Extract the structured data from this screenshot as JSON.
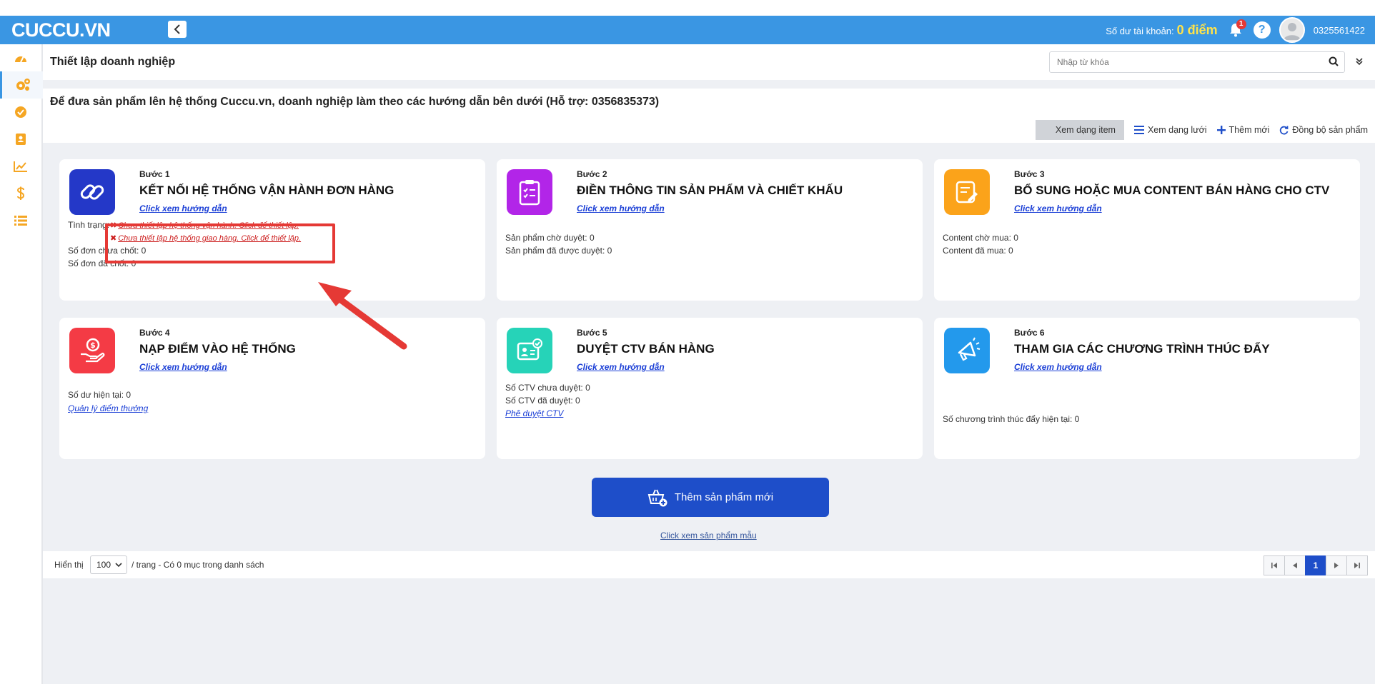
{
  "app": {
    "logo": "CUCCU.VN",
    "balance_label": "Số dư tài khoản:",
    "balance_value": "0 điểm",
    "notification_count": "1",
    "help_symbol": "?",
    "username": "0325561422"
  },
  "sidebar": {
    "items": [
      {
        "icon": "dashboard-icon"
      },
      {
        "icon": "settings-icon",
        "active": true
      },
      {
        "icon": "check-circle-icon"
      },
      {
        "icon": "contact-book-icon"
      },
      {
        "icon": "chart-line-icon"
      },
      {
        "icon": "dollar-icon"
      },
      {
        "icon": "list-icon"
      }
    ]
  },
  "header": {
    "title": "Thiết lập doanh nghiệp",
    "search_placeholder": "Nhập từ khóa"
  },
  "guide": {
    "text": "Để đưa sản phẩm lên hệ thống Cuccu.vn, doanh nghiệp làm theo các hướng dẫn bên dưới (Hỗ trợ: 0356835373)"
  },
  "view_tools": {
    "item_view": "Xem dạng item",
    "grid_view": "Xem dạng lưới",
    "add_new": "Thêm mới",
    "sync": "Đồng bộ sản phẩm"
  },
  "steps": [
    {
      "step": "Bước 1",
      "title": "KẾT NỐI HỆ THỐNG VẬN HÀNH ĐƠN HÀNG",
      "link": "Click xem hướng dẫn",
      "color": "#2438c8",
      "status_label": "Tình trạng:",
      "warnings": [
        "Chưa thiết lập hệ thống vận hành. Click để thiết lập.",
        "Chưa thiết lập hệ thống giao hàng. Click để thiết lập."
      ],
      "stats": [
        "Số đơn chưa chốt: 0",
        "Số đơn đã chốt: 0"
      ]
    },
    {
      "step": "Bước 2",
      "title": "ĐIỀN THÔNG TIN SẢN PHẨM VÀ CHIẾT KHẤU",
      "link": "Click xem hướng dẫn",
      "color": "#b225e8",
      "stats": [
        "Sản phẩm chờ duyệt: 0",
        "Sản phẩm đã được duyệt: 0"
      ]
    },
    {
      "step": "Bước 3",
      "title": "BỔ SUNG HOẶC MUA CONTENT BÁN HÀNG CHO CTV",
      "link": "Click xem hướng dẫn",
      "color": "#fba31a",
      "stats": [
        "Content chờ mua: 0",
        "Content đã mua: 0"
      ]
    },
    {
      "step": "Bước 4",
      "title": "NẠP ĐIỂM VÀO HỆ THỐNG",
      "link": "Click xem hướng dẫn",
      "color": "#f43b45",
      "stats": [
        "Số dư hiện tại: 0"
      ],
      "extra_link": "Quản lý điểm thưởng"
    },
    {
      "step": "Bước 5",
      "title": "DUYỆT CTV BÁN HÀNG",
      "link": "Click xem hướng dẫn",
      "color": "#26d3b8",
      "stats": [
        "Số CTV chưa duyệt: 0",
        "Số CTV đã duyệt: 0"
      ],
      "extra_link": "Phê duyệt CTV"
    },
    {
      "step": "Bước 6",
      "title": "THAM GIA CÁC CHƯƠNG TRÌNH THÚC ĐẨY",
      "link": "Click xem hướng dẫn",
      "color": "#2399ec",
      "stats": [
        "Số chương trình thúc đẩy hiện tại: 0"
      ]
    }
  ],
  "actions": {
    "add_product": "Thêm sản phẩm mới",
    "sample_link": "Click xem sản phẩm mẫu"
  },
  "pagination": {
    "show_label": "Hiển thị",
    "page_size": "100",
    "summary": "/ trang - Có 0 mục trong danh sách",
    "current_page": "1"
  }
}
